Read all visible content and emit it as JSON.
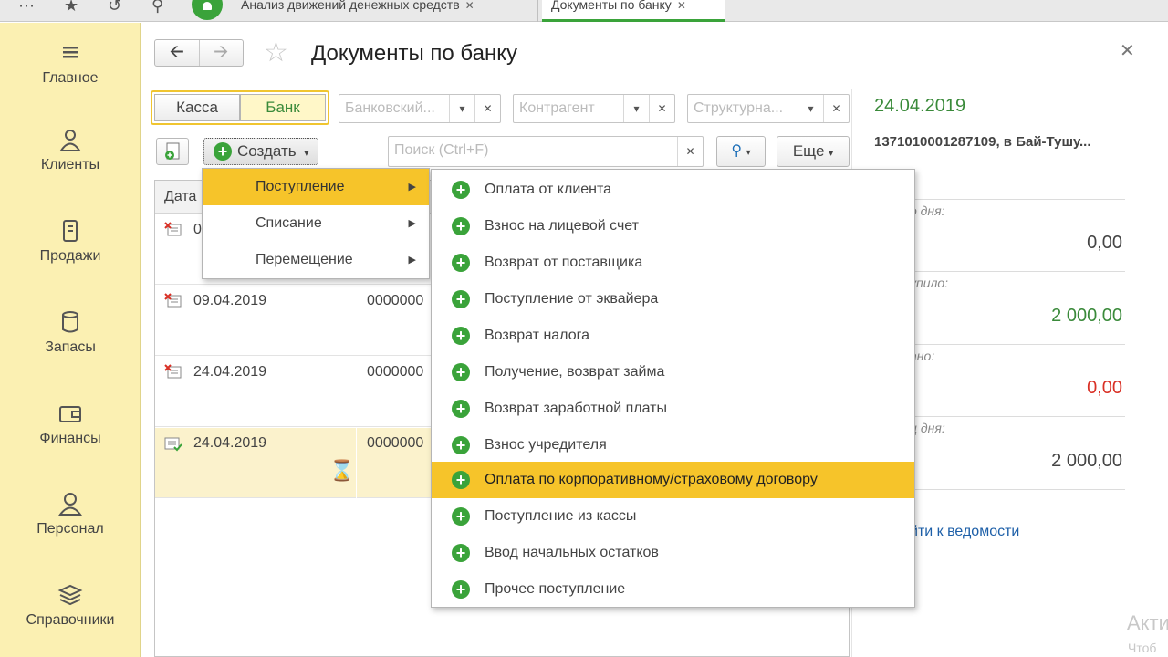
{
  "topbar": {
    "tabs": [
      {
        "label": "Анализ движений денежных средств"
      },
      {
        "label": "Документы по банку"
      }
    ]
  },
  "sidebar": {
    "items": [
      {
        "label": "Главное",
        "icon": "menu-icon"
      },
      {
        "label": "Клиенты",
        "icon": "clients-icon"
      },
      {
        "label": "Продажи",
        "icon": "sales-icon"
      },
      {
        "label": "Запасы",
        "icon": "stock-icon"
      },
      {
        "label": "Финансы",
        "icon": "wallet-icon"
      },
      {
        "label": "Персонал",
        "icon": "person-icon"
      },
      {
        "label": "Справочники",
        "icon": "books-icon"
      }
    ]
  },
  "header": {
    "title": "Документы по банку"
  },
  "toolbar": {
    "toggle_kassa": "Касса",
    "toggle_bank": "Банк",
    "filter_bank_account": "Банковский...",
    "filter_counterparty": "Контрагент",
    "filter_structure": "Структурна...",
    "create_label": "Создать",
    "search_placeholder": "Поиск (Ctrl+F)",
    "more_label": "Еще"
  },
  "grid": {
    "header_date": "Дата",
    "rows": [
      {
        "date": "0",
        "number": ""
      },
      {
        "date": "09.04.2019",
        "number": "0000000"
      },
      {
        "date": "24.04.2019",
        "number": "0000000"
      },
      {
        "date": "24.04.2019",
        "number": "0000000"
      }
    ]
  },
  "create_menu": {
    "items": [
      {
        "label": "Поступление"
      },
      {
        "label": "Списание"
      },
      {
        "label": "Перемещение"
      }
    ]
  },
  "receipt_submenu": {
    "items": [
      {
        "label": "Оплата от клиента"
      },
      {
        "label": "Взнос на лицевой счет"
      },
      {
        "label": "Возврат от поставщика"
      },
      {
        "label": "Поступление от эквайера"
      },
      {
        "label": "Возврат налога"
      },
      {
        "label": "Получение, возврат займа"
      },
      {
        "label": "Возврат заработной платы"
      },
      {
        "label": "Взнос учредителя"
      },
      {
        "label": "Оплата по корпоративному/страховому договору"
      },
      {
        "label": "Поступление из кассы"
      },
      {
        "label": "Ввод начальных остатков"
      },
      {
        "label": "Прочее поступление"
      }
    ]
  },
  "right_panel": {
    "date": "24.04.2019",
    "account": "1371010001287109, в Бай-Тушу...",
    "start_label": "о дня:",
    "start_value": "0,00",
    "in_label": "упило:",
    "in_value": "2 000,00",
    "out_label": "ано:",
    "out_value": "0,00",
    "end_label": "ц дня:",
    "end_value": "2 000,00",
    "link": "йти к ведомости"
  },
  "watermark": {
    "line1": "Акти",
    "line2": "Чтоб"
  },
  "colors": {
    "accent_green": "#3aa33a",
    "highlight_yellow": "#f6c42a",
    "sidebar_bg": "#fbf0b2",
    "negative_red": "#d93025",
    "link_blue": "#1d5fa8"
  }
}
